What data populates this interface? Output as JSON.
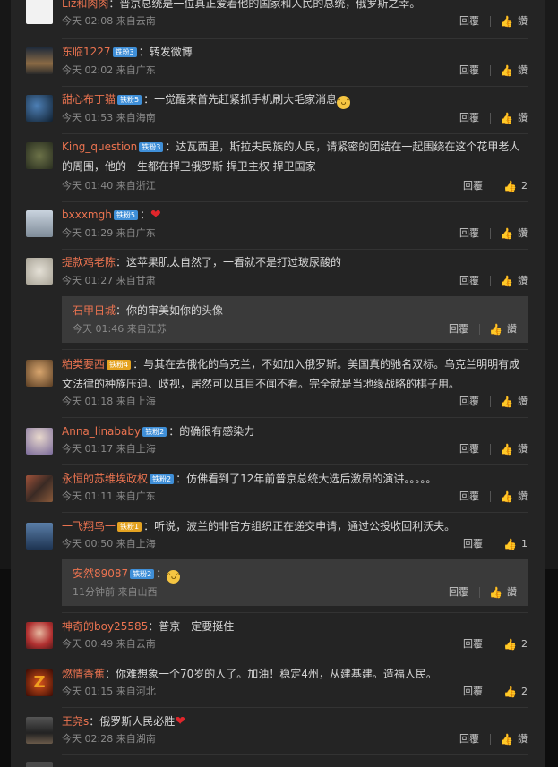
{
  "comments": [
    {
      "user": "Liz和肉肉",
      "badge": "",
      "badge_type": "",
      "text": "：普京总统是一位真正爱着他的国家和人民的总统，俄罗斯之幸。",
      "time": "今天 02:08 来自云南",
      "reply": "回覆",
      "like": "讚",
      "avatar_color": "#f2f2f2"
    },
    {
      "user": "东临1227",
      "badge": "铁粉3",
      "badge_type": "blue",
      "text": "：转发微博",
      "time": "今天 02:02 来自广东",
      "reply": "回覆",
      "like": "讚",
      "avatar_color": "#6b5a44"
    },
    {
      "user": "甜心布丁猫",
      "badge": "铁粉5",
      "badge_type": "blue",
      "text": "：一觉醒来首先赶紧抓手机刷大毛家消息",
      "emoji": "😄",
      "time": "今天 01:53 来自海南",
      "reply": "回覆",
      "like": "讚",
      "avatar_color": "#2a3f5f"
    },
    {
      "user": "King_question",
      "badge": "铁粉3",
      "badge_type": "blue",
      "text": "：达瓦西里，斯拉夫民族的人民，请紧密的团结在一起围绕在这个花甲老人的周围，他的一生都在捍卫俄罗斯 捍卫主权 捍卫国家",
      "time": "今天 01:40 来自浙江",
      "reply": "回覆",
      "like": "讚",
      "likes": "2",
      "avatar_color": "#5b6340"
    },
    {
      "user": "bxxxmgh",
      "badge": "铁粉5",
      "badge_type": "blue",
      "text": "：",
      "heart": "❤️",
      "time": "今天 01:29 来自广东",
      "reply": "回覆",
      "like": "讚",
      "avatar_color": "#9aa7b5"
    },
    {
      "user": "提款鸡老陈",
      "badge": "",
      "badge_type": "",
      "text": "：这苹果肌太自然了，一看就不是打过玻尿酸的",
      "time": "今天 01:27 来自甘肃",
      "reply": "回覆",
      "like": "讚",
      "avatar_color": "#c9c4b8"
    },
    {
      "user": "粕类要西",
      "badge": "铁粉4",
      "badge_type": "gold",
      "text": "：与其在去俄化的乌克兰，不如加入俄罗斯。美国真的驰名双标。乌克兰明明有成文法律的种族压迫、歧视，居然可以耳目不闻不看。完全就是当地缘战略的棋子用。",
      "time": "今天 01:18 来自上海",
      "reply": "回覆",
      "like": "讚",
      "avatar_color": "#8a6a48"
    },
    {
      "user": "Anna_linababy",
      "badge": "铁粉2",
      "badge_type": "blue",
      "text": "：的确很有感染力",
      "time": "今天 01:17 来自上海",
      "reply": "回覆",
      "like": "讚",
      "avatar_color": "#b8a4c4"
    },
    {
      "user": "永恒的苏维埃政权",
      "badge": "铁粉2",
      "badge_type": "blue",
      "text": "：仿佛看到了12年前普京总统大选后激昂的演讲。。。。。",
      "time": "今天 01:11 来自广东",
      "reply": "回覆",
      "like": "讚",
      "avatar_color": "#7a3e2c"
    },
    {
      "user": "一飞翔鸟一",
      "badge": "铁粉1",
      "badge_type": "gold",
      "text": "：听说，波兰的非官方组织正在递交申请，通过公投收回利沃夫。",
      "time": "今天 00:50 来自上海",
      "reply": "回覆",
      "like": "讚",
      "likes": "1",
      "avatar_color": "#3d5a7a"
    },
    {
      "user": "神奇的boy25585",
      "badge": "",
      "badge_type": "",
      "text": "：普京一定要挺住",
      "time": "今天 00:49 来自云南",
      "reply": "回覆",
      "like": "讚",
      "likes": "2",
      "avatar_color": "#b03030"
    },
    {
      "user": "燃情香蕉",
      "badge": "",
      "badge_type": "",
      "text": "：你难想象一个70岁的人了。加油！稳定4州，从建基建。造福人民。",
      "time": "今天 01:15 来自河北",
      "reply": "回覆",
      "like": "讚",
      "likes": "2",
      "avatar_color": "#5a1a0a"
    },
    {
      "user": "王尧s",
      "badge": "",
      "badge_type": "",
      "text": "：俄罗斯人民必胜",
      "heart": "❤️",
      "time": "今天 02:28 来自湖南",
      "reply": "回覆",
      "like": "讚",
      "avatar_color": "#3a3a3a"
    }
  ],
  "replies": [
    {
      "user": "石甲日城",
      "text": "：你的审美如你的头像",
      "time": "今天 01:46 来自江苏",
      "reply": "回覆",
      "like": "讚"
    },
    {
      "user": "安然89087",
      "badge": "铁粉2",
      "text": "：",
      "emoji": "😄",
      "time": "11分钟前 来自山西",
      "reply": "回覆",
      "like": "讚"
    }
  ]
}
